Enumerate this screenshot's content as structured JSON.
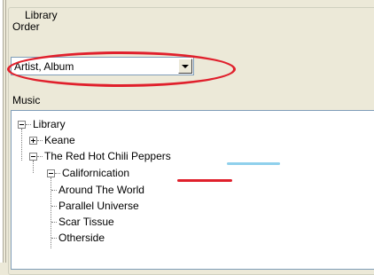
{
  "groupbox": {
    "title": "Library"
  },
  "order": {
    "label": "Order",
    "selected": "Artist, Album"
  },
  "music": {
    "label": "Music"
  },
  "tree": {
    "root": "Library",
    "artists": [
      "Keane",
      "The Red Hot Chili Peppers"
    ],
    "album": "Californication",
    "tracks": [
      "Around The World",
      "Parallel Universe",
      "Scar Tissue",
      "Otherside"
    ]
  },
  "colors": {
    "highlight_red": "#e0202c",
    "highlight_blue": "#8fd0ec"
  }
}
